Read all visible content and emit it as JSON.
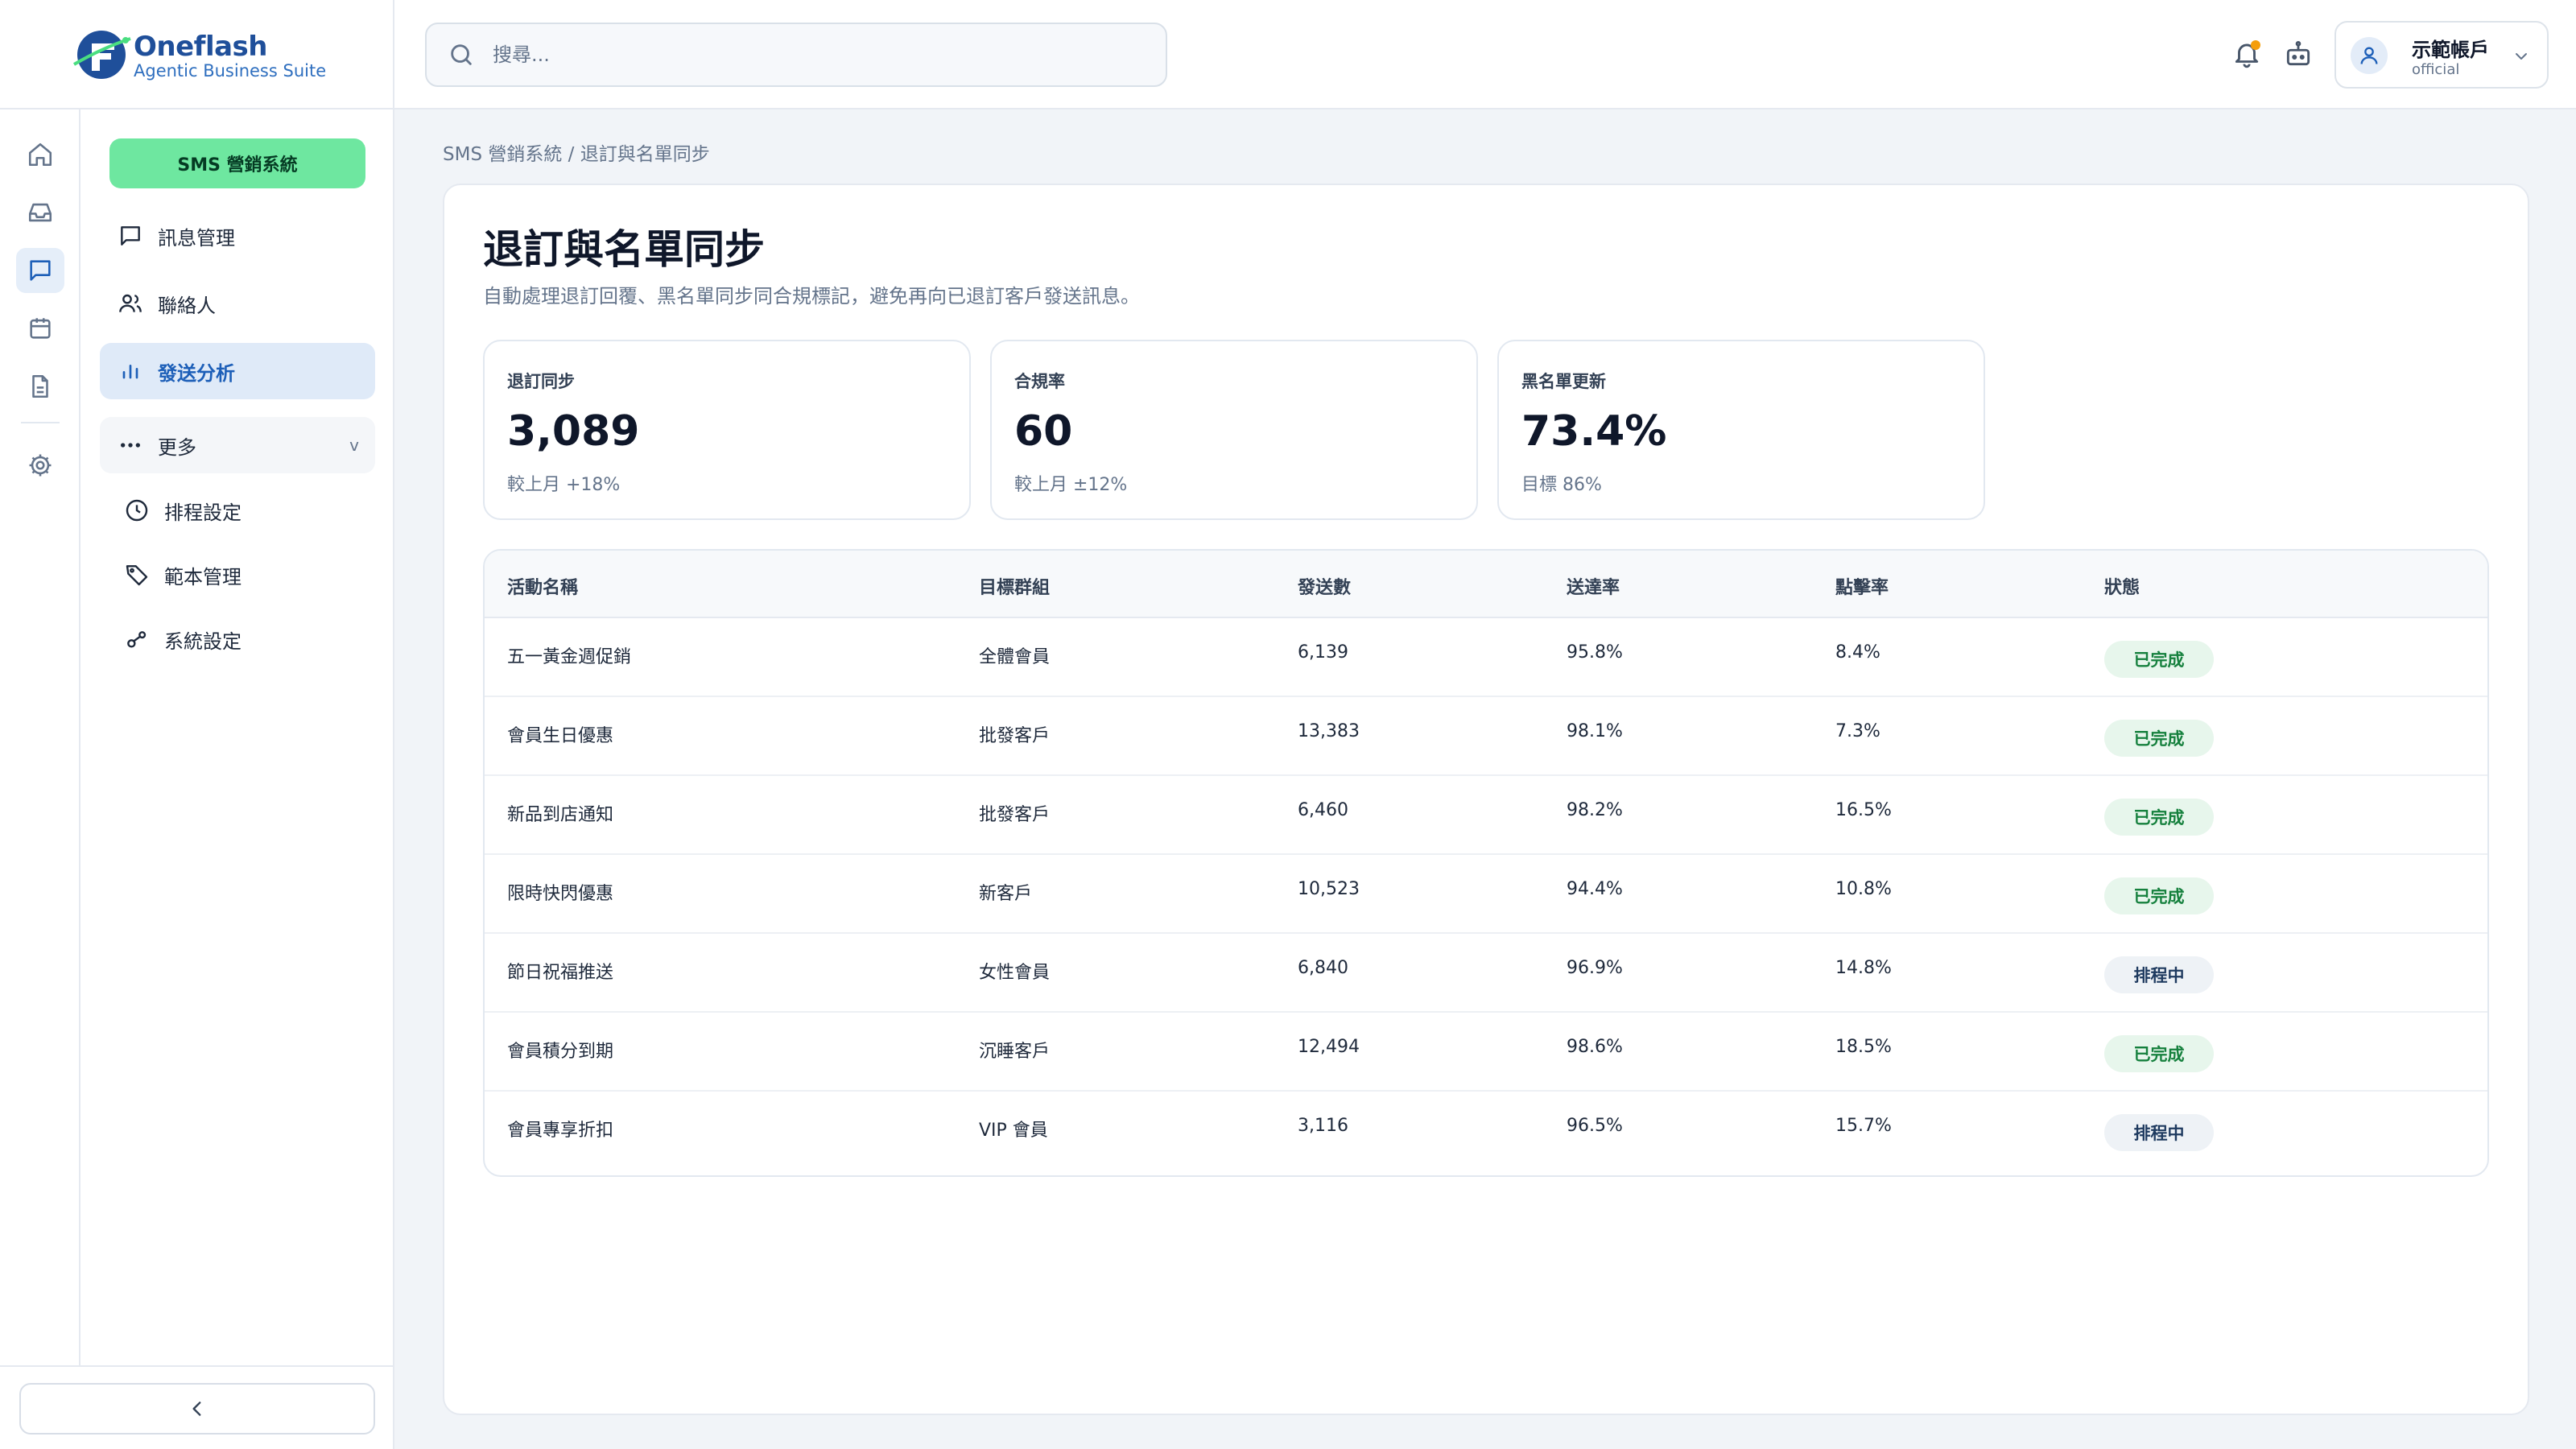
{
  "brand": {
    "name": "Oneflash",
    "tagline": "Agentic Business Suite"
  },
  "rail": [
    "home-icon",
    "inbox-icon",
    "chat-icon",
    "calendar-icon",
    "file-icon",
    "gear-icon"
  ],
  "sidebar": {
    "system_label": "SMS 營銷系統",
    "items": [
      {
        "label": "訊息管理",
        "icon": "message-square-icon"
      },
      {
        "label": "聯絡人",
        "icon": "users-icon"
      },
      {
        "label": "發送分析",
        "icon": "bar-chart-icon",
        "active": true
      },
      {
        "label": "更多",
        "icon": "more-dots-icon",
        "chevron": "v"
      }
    ],
    "sub_items": [
      {
        "label": "排程設定",
        "icon": "clock-icon"
      },
      {
        "label": "範本管理",
        "icon": "tag-icon"
      },
      {
        "label": "系統設定",
        "icon": "settings-link-icon"
      }
    ],
    "collapse_icon": "chevron-left-icon"
  },
  "topbar": {
    "search_placeholder": "搜尋...",
    "account": {
      "name": "示範帳戶",
      "role": "official"
    }
  },
  "breadcrumb": "SMS 營銷系統 / 退訂與名單同步",
  "page": {
    "title": "退訂與名單同步",
    "description": "自動處理退訂回覆、黑名單同步同合規標記，避免再向已退訂客戶發送訊息。"
  },
  "stats": [
    {
      "label": "退訂同步",
      "value": "3,089",
      "sub": "較上月 +18%"
    },
    {
      "label": "合規率",
      "value": "60",
      "sub": "較上月 ±12%"
    },
    {
      "label": "黑名單更新",
      "value": "73.4%",
      "sub": "目標 86%"
    }
  ],
  "table": {
    "headers": [
      "活動名稱",
      "目標群組",
      "發送數",
      "送達率",
      "點擊率",
      "狀態"
    ],
    "rows": [
      {
        "name": "五一黃金週促銷",
        "group": "全體會員",
        "sent": "6,139",
        "delivery": "95.8%",
        "ctr": "8.4%",
        "status": "已完成",
        "kind": "done"
      },
      {
        "name": "會員生日優惠",
        "group": "批發客戶",
        "sent": "13,383",
        "delivery": "98.1%",
        "ctr": "7.3%",
        "status": "已完成",
        "kind": "done"
      },
      {
        "name": "新品到店通知",
        "group": "批發客戶",
        "sent": "6,460",
        "delivery": "98.2%",
        "ctr": "16.5%",
        "status": "已完成",
        "kind": "done"
      },
      {
        "name": "限時快閃優惠",
        "group": "新客戶",
        "sent": "10,523",
        "delivery": "94.4%",
        "ctr": "10.8%",
        "status": "已完成",
        "kind": "done"
      },
      {
        "name": "節日祝福推送",
        "group": "女性會員",
        "sent": "6,840",
        "delivery": "96.9%",
        "ctr": "14.8%",
        "status": "排程中",
        "kind": "sched"
      },
      {
        "name": "會員積分到期",
        "group": "沉睡客戶",
        "sent": "12,494",
        "delivery": "98.6%",
        "ctr": "18.5%",
        "status": "已完成",
        "kind": "done"
      },
      {
        "name": "會員專享折扣",
        "group": "VIP 會員",
        "sent": "3,116",
        "delivery": "96.5%",
        "ctr": "15.7%",
        "status": "排程中",
        "kind": "sched"
      }
    ]
  },
  "colors": {
    "accent": "#1d5fb8",
    "pill_green": "#6ee7a0",
    "badge_done_bg": "#e7f6ec",
    "badge_done_text": "#15803d",
    "badge_sched_bg": "#eef2f6",
    "notification_dot": "#f59e0b"
  }
}
